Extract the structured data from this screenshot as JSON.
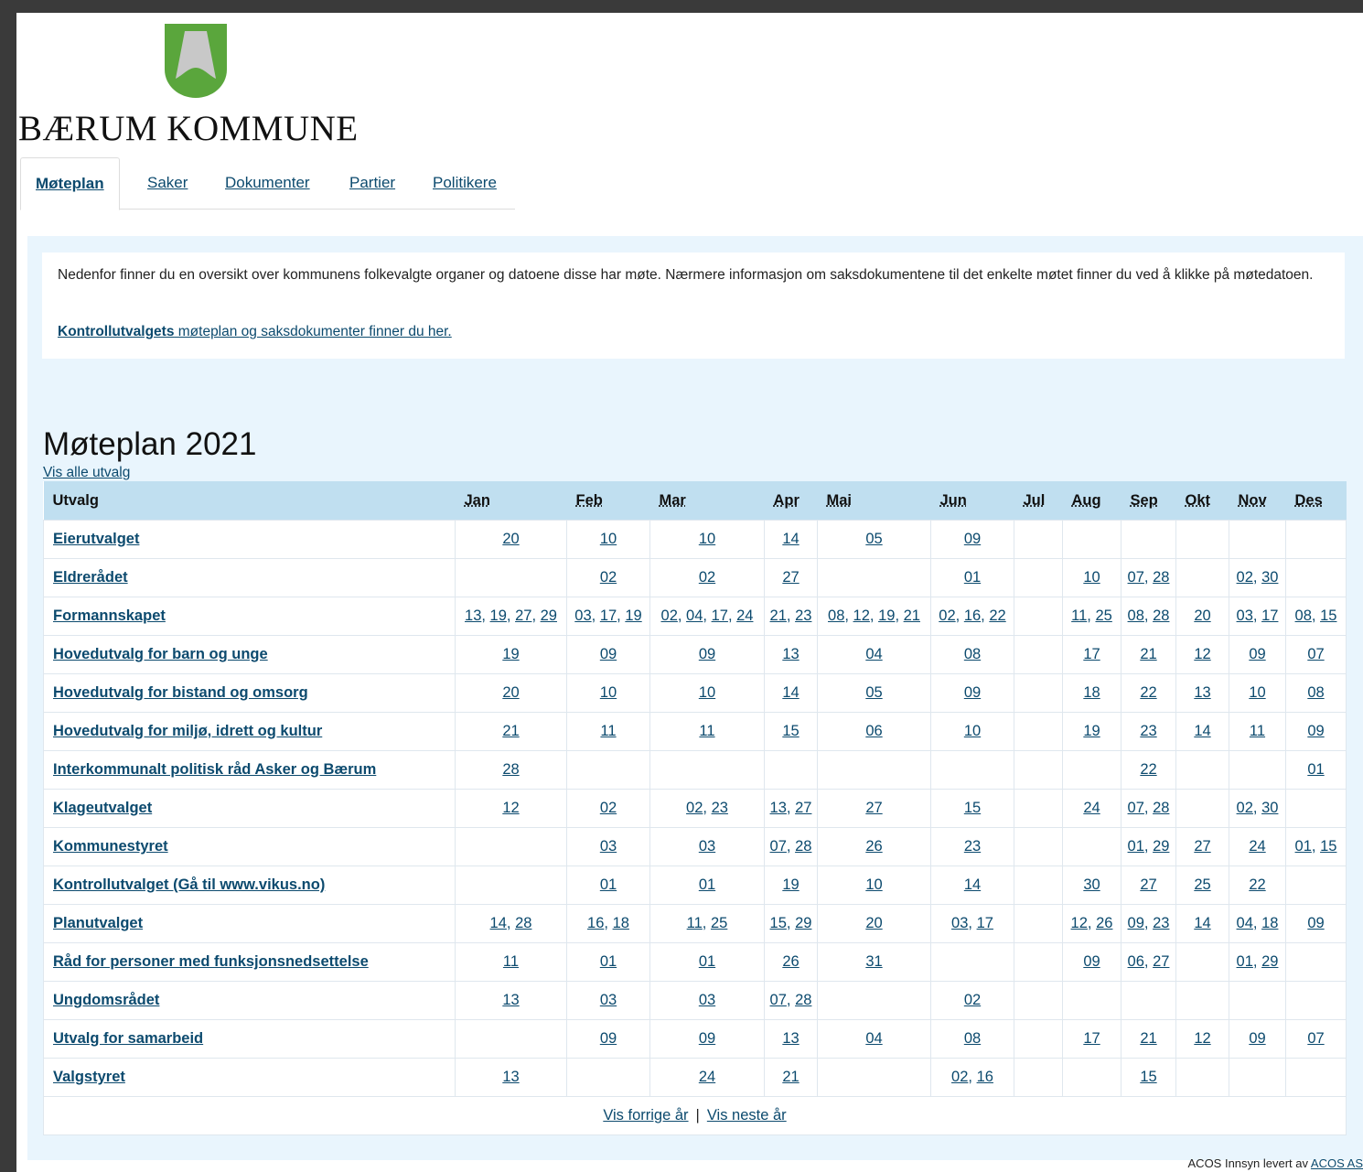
{
  "brand": {
    "name": "BÆRUM KOMMUNE",
    "shield_green": "#5aa63c",
    "shield_grey": "#c8c8c8"
  },
  "tabs": [
    "Møteplan",
    "Saker",
    "Dokumenter",
    "Partier",
    "Politikere"
  ],
  "intro": {
    "text": "Nedenfor finner du en oversikt over kommunens folkevalgte organer og datoene disse har møte. Nærmere informasjon om saksdokumentene til det enkelte møtet finner du ved å klikke på møtedatoen.",
    "link_bold": "Kontrollutvalgets",
    "link_rest": " møteplan og saksdokumenter finner du her."
  },
  "heading": "Møteplan 2021",
  "show_all": "Vis alle utvalg",
  "table": {
    "col_utvalg": "Utvalg",
    "months": [
      "Jan",
      "Feb",
      "Mar",
      "Apr",
      "Mai",
      "Jun",
      "Jul",
      "Aug",
      "Sep",
      "Okt",
      "Nov",
      "Des"
    ],
    "rows": [
      {
        "name": "Eierutvalget",
        "dates": [
          [
            "20"
          ],
          [
            "10"
          ],
          [
            "10"
          ],
          [
            "14"
          ],
          [
            "05"
          ],
          [
            "09"
          ],
          [],
          [],
          [],
          [],
          [],
          []
        ]
      },
      {
        "name": "Eldrerådet",
        "dates": [
          [],
          [
            "02"
          ],
          [
            "02"
          ],
          [
            "27"
          ],
          [],
          [
            "01"
          ],
          [],
          [
            "10"
          ],
          [
            "07",
            "28"
          ],
          [],
          [
            "02",
            "30"
          ],
          []
        ]
      },
      {
        "name": "Formannskapet",
        "dates": [
          [
            "13",
            "19",
            "27",
            "29"
          ],
          [
            "03",
            "17",
            "19"
          ],
          [
            "02",
            "04",
            "17",
            "24"
          ],
          [
            "21",
            "23"
          ],
          [
            "08",
            "12",
            "19",
            "21"
          ],
          [
            "02",
            "16",
            "22"
          ],
          [],
          [
            "11",
            "25"
          ],
          [
            "08",
            "28"
          ],
          [
            "20"
          ],
          [
            "03",
            "17"
          ],
          [
            "08",
            "15"
          ]
        ]
      },
      {
        "name": "Hovedutvalg for barn og unge",
        "dates": [
          [
            "19"
          ],
          [
            "09"
          ],
          [
            "09"
          ],
          [
            "13"
          ],
          [
            "04"
          ],
          [
            "08"
          ],
          [],
          [
            "17"
          ],
          [
            "21"
          ],
          [
            "12"
          ],
          [
            "09"
          ],
          [
            "07"
          ]
        ]
      },
      {
        "name": "Hovedutvalg for bistand og omsorg",
        "dates": [
          [
            "20"
          ],
          [
            "10"
          ],
          [
            "10"
          ],
          [
            "14"
          ],
          [
            "05"
          ],
          [
            "09"
          ],
          [],
          [
            "18"
          ],
          [
            "22"
          ],
          [
            "13"
          ],
          [
            "10"
          ],
          [
            "08"
          ]
        ]
      },
      {
        "name": "Hovedutvalg for miljø, idrett og kultur",
        "dates": [
          [
            "21"
          ],
          [
            "11"
          ],
          [
            "11"
          ],
          [
            "15"
          ],
          [
            "06"
          ],
          [
            "10"
          ],
          [],
          [
            "19"
          ],
          [
            "23"
          ],
          [
            "14"
          ],
          [
            "11"
          ],
          [
            "09"
          ]
        ]
      },
      {
        "name": "Interkommunalt politisk råd Asker og Bærum",
        "dates": [
          [
            "28"
          ],
          [],
          [],
          [],
          [],
          [],
          [],
          [],
          [
            "22"
          ],
          [],
          [],
          [
            "01"
          ]
        ]
      },
      {
        "name": "Klageutvalget",
        "dates": [
          [
            "12"
          ],
          [
            "02"
          ],
          [
            "02",
            "23"
          ],
          [
            "13",
            "27"
          ],
          [
            "27"
          ],
          [
            "15"
          ],
          [],
          [
            "24"
          ],
          [
            "07",
            "28"
          ],
          [],
          [
            "02",
            "30"
          ],
          []
        ]
      },
      {
        "name": "Kommunestyret",
        "dates": [
          [],
          [
            "03"
          ],
          [
            "03"
          ],
          [
            "07",
            "28"
          ],
          [
            "26"
          ],
          [
            "23"
          ],
          [],
          [],
          [
            "01",
            "29"
          ],
          [
            "27"
          ],
          [
            "24"
          ],
          [
            "01",
            "15"
          ]
        ]
      },
      {
        "name": "Kontrollutvalget (Gå til www.vikus.no)",
        "dates": [
          [],
          [
            "01"
          ],
          [
            "01"
          ],
          [
            "19"
          ],
          [
            "10"
          ],
          [
            "14"
          ],
          [],
          [
            "30"
          ],
          [
            "27"
          ],
          [
            "25"
          ],
          [
            "22"
          ],
          []
        ]
      },
      {
        "name": "Planutvalget",
        "dates": [
          [
            "14",
            "28"
          ],
          [
            "16",
            "18"
          ],
          [
            "11",
            "25"
          ],
          [
            "15",
            "29"
          ],
          [
            "20"
          ],
          [
            "03",
            "17"
          ],
          [],
          [
            "12",
            "26"
          ],
          [
            "09",
            "23"
          ],
          [
            "14"
          ],
          [
            "04",
            "18"
          ],
          [
            "09"
          ]
        ]
      },
      {
        "name": "Råd for personer med funksjonsnedsettelse",
        "dates": [
          [
            "11"
          ],
          [
            "01"
          ],
          [
            "01"
          ],
          [
            "26"
          ],
          [
            "31"
          ],
          [],
          [],
          [
            "09"
          ],
          [
            "06",
            "27"
          ],
          [],
          [
            "01",
            "29"
          ],
          []
        ]
      },
      {
        "name": "Ungdomsrådet",
        "dates": [
          [
            "13"
          ],
          [
            "03"
          ],
          [
            "03"
          ],
          [
            "07",
            "28"
          ],
          [],
          [
            "02"
          ],
          [],
          [],
          [],
          [],
          [],
          []
        ]
      },
      {
        "name": "Utvalg for samarbeid",
        "dates": [
          [],
          [
            "09"
          ],
          [
            "09"
          ],
          [
            "13"
          ],
          [
            "04"
          ],
          [
            "08"
          ],
          [],
          [
            "17"
          ],
          [
            "21"
          ],
          [
            "12"
          ],
          [
            "09"
          ],
          [
            "07"
          ]
        ]
      },
      {
        "name": "Valgstyret",
        "dates": [
          [
            "13"
          ],
          [],
          [
            "24"
          ],
          [
            "21"
          ],
          [],
          [
            "02",
            "16"
          ],
          [],
          [],
          [
            "15"
          ],
          [],
          [],
          []
        ]
      }
    ],
    "prev_year": "Vis forrige år",
    "separator": "|",
    "next_year": "Vis neste år"
  },
  "footer": {
    "text": "ACOS Innsyn levert av ",
    "link": "ACOS AS"
  }
}
